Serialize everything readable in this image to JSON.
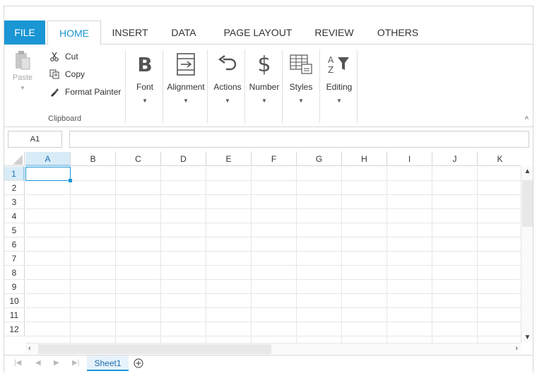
{
  "tabs": {
    "file": "FILE",
    "home": "HOME",
    "insert": "INSERT",
    "data": "DATA",
    "page_layout": "PAGE LAYOUT",
    "review": "REVIEW",
    "others": "OTHERS"
  },
  "clipboard": {
    "paste": "Paste",
    "cut": "Cut",
    "copy": "Copy",
    "format_painter": "Format Painter",
    "group_label": "Clipboard"
  },
  "ribbon_buttons": {
    "font": "Font",
    "alignment": "Alignment",
    "actions": "Actions",
    "number": "Number",
    "styles": "Styles",
    "editing": "Editing"
  },
  "formula_bar": {
    "name_box": "A1",
    "formula": ""
  },
  "columns": [
    "A",
    "B",
    "C",
    "D",
    "E",
    "F",
    "G",
    "H",
    "I",
    "J",
    "K"
  ],
  "rows": [
    "1",
    "2",
    "3",
    "4",
    "5",
    "6",
    "7",
    "8",
    "9",
    "10",
    "11",
    "12"
  ],
  "active_cell": {
    "column": "A",
    "row": "1"
  },
  "sheets": [
    "Sheet1"
  ],
  "colors": {
    "accent": "#1a96d4",
    "header_active": "#d8ecf8",
    "grid_line": "#e6e6e6"
  }
}
